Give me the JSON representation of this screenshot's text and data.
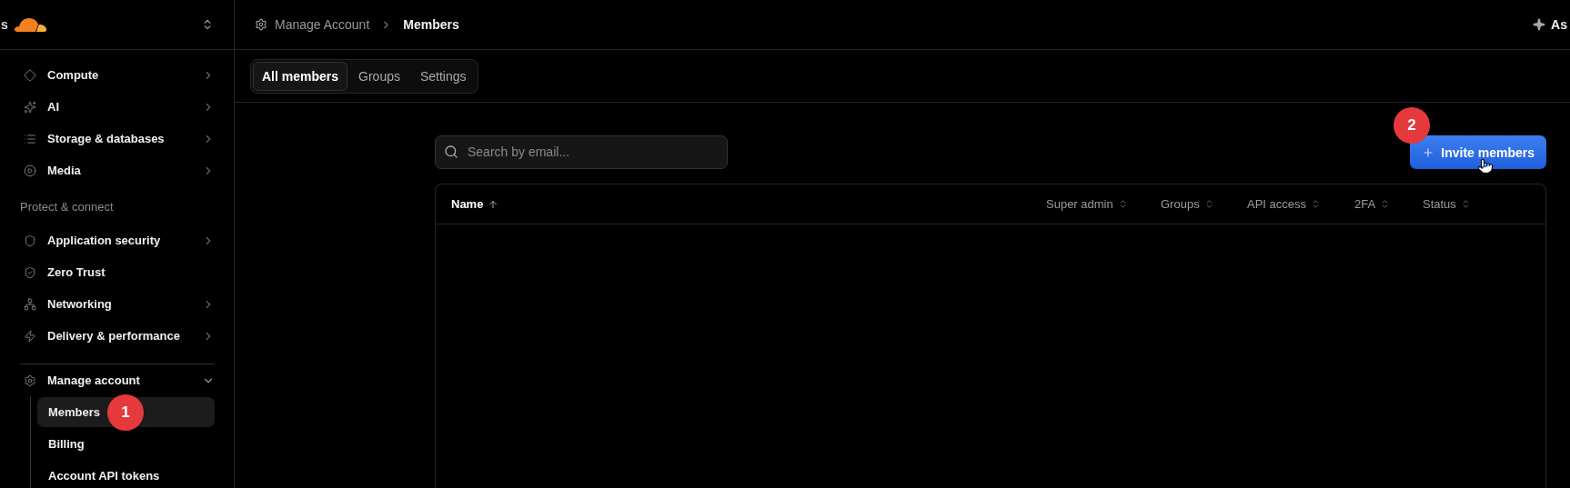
{
  "sidebar": {
    "edge_text": "s",
    "sections": [
      {
        "items": [
          {
            "label": "Compute",
            "expandable": true,
            "expanded": false
          },
          {
            "label": "AI",
            "expandable": true,
            "expanded": false
          },
          {
            "label": "Storage & databases",
            "expandable": true,
            "expanded": false
          },
          {
            "label": "Media",
            "expandable": true,
            "expanded": false
          }
        ]
      },
      {
        "heading": "Protect & connect",
        "items": [
          {
            "label": "Application security",
            "expandable": true,
            "expanded": false
          },
          {
            "label": "Zero Trust",
            "expandable": false
          },
          {
            "label": "Networking",
            "expandable": true,
            "expanded": false
          },
          {
            "label": "Delivery & performance",
            "expandable": true,
            "expanded": false
          }
        ]
      },
      {
        "divider": true,
        "items": [
          {
            "label": "Manage account",
            "expandable": true,
            "expanded": true,
            "children": [
              {
                "label": "Members",
                "selected": true,
                "step_badge": "1"
              },
              {
                "label": "Billing",
                "selected": false
              },
              {
                "label": "Account API tokens",
                "selected": false
              }
            ]
          }
        ]
      }
    ]
  },
  "topbar": {
    "breadcrumb": [
      "Manage Account",
      "Members"
    ],
    "edge_text": "As"
  },
  "tabs": [
    {
      "label": "All members",
      "selected": true
    },
    {
      "label": "Groups",
      "selected": false
    },
    {
      "label": "Settings",
      "selected": false
    }
  ],
  "search": {
    "placeholder": "Search by email..."
  },
  "invite_button": {
    "label": "Invite members",
    "step_badge": "2"
  },
  "table": {
    "columns": [
      {
        "label": "Name",
        "sorted": true
      },
      {
        "label": "Super admin",
        "sorted": false
      },
      {
        "label": "Groups",
        "sorted": false
      },
      {
        "label": "API access",
        "sorted": false
      },
      {
        "label": "2FA",
        "sorted": false
      },
      {
        "label": "Status",
        "sorted": false
      }
    ]
  }
}
